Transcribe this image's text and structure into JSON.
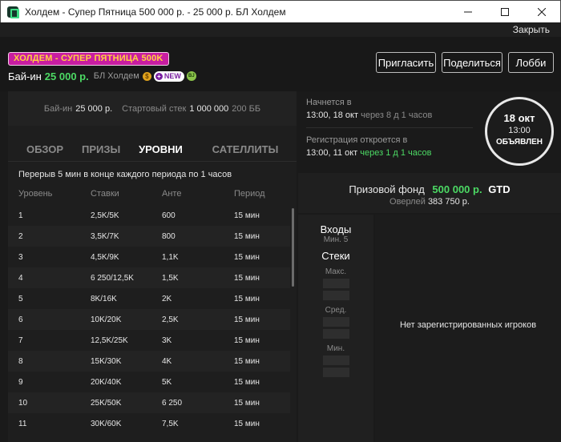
{
  "window": {
    "title": "Холдем - Супер Пятница 500 000 р. - 25 000 р. БЛ Холдем",
    "close_link": "Закрыть"
  },
  "header": {
    "promo_badge": "ХОЛДЕМ - СУПЕР ПЯТНИЦА 500K",
    "buyin_label": "Бай-ин",
    "buyin_value": "25 000 р.",
    "game_type": "БЛ Холдем",
    "coin_glyph": "$",
    "new_badge": "NEW",
    "bj_badge": "BJ",
    "buttons": {
      "invite": "Пригласить",
      "share": "Поделиться",
      "lobby": "Лобби"
    }
  },
  "info_strip": {
    "buyin_label": "Бай-ин",
    "buyin_value": "25 000 р.",
    "stack_label": "Стартовый стек",
    "stack_value": "1 000 000",
    "stack_bb": "200 ББ"
  },
  "tabs": [
    "ОБЗОР",
    "ПРИЗЫ",
    "УРОВНИ",
    "САТЕЛЛИТЫ"
  ],
  "active_tab": "УРОВНИ",
  "levels": {
    "note": "Перерыв 5 мин в конце каждого периода по 1 часов",
    "columns": [
      "Уровень",
      "Ставки",
      "Анте",
      "Период"
    ],
    "rows": [
      [
        "1",
        "2,5K/5K",
        "600",
        "15 мин"
      ],
      [
        "2",
        "3,5K/7K",
        "800",
        "15 мин"
      ],
      [
        "3",
        "4,5K/9K",
        "1,1K",
        "15 мин"
      ],
      [
        "4",
        "6 250/12,5K",
        "1,5K",
        "15 мин"
      ],
      [
        "5",
        "8K/16K",
        "2K",
        "15 мин"
      ],
      [
        "6",
        "10K/20K",
        "2,5K",
        "15 мин"
      ],
      [
        "7",
        "12,5K/25K",
        "3K",
        "15 мин"
      ],
      [
        "8",
        "15K/30K",
        "4K",
        "15 мин"
      ],
      [
        "9",
        "20K/40K",
        "5K",
        "15 мин"
      ],
      [
        "10",
        "25K/50K",
        "6 250",
        "15 мин"
      ],
      [
        "11",
        "30K/60K",
        "7,5K",
        "15 мин"
      ]
    ]
  },
  "schedule": {
    "starts_label": "Начнется в",
    "starts_value": "13:00, 18 окт",
    "starts_rel": "через 8 д 1 часов",
    "reg_label": "Регистрация откроется в",
    "reg_value": "13:00, 11 окт",
    "reg_rel": "через 1 д 1 часов"
  },
  "date_badge": {
    "date": "18 окт",
    "time": "13:00",
    "status": "ОБЪЯВЛЕН"
  },
  "prize": {
    "label": "Призовой фонд",
    "amount": "500 000 р.",
    "gtd": "GTD",
    "overlay_label": "Оверлей",
    "overlay_value": "383 750 р."
  },
  "stats": {
    "entries_label": "Входы",
    "entries_min": "Мин. 5",
    "stacks_label": "Стеки",
    "max_label": "Макс.",
    "avg_label": "Сред.",
    "min_label": "Мин."
  },
  "players": {
    "empty_text": "Нет зарегистрированных игроков"
  },
  "colors": {
    "accent_green": "#4cd964",
    "promo_pink": "#c81da1",
    "promo_yellow": "#ffd23f"
  }
}
